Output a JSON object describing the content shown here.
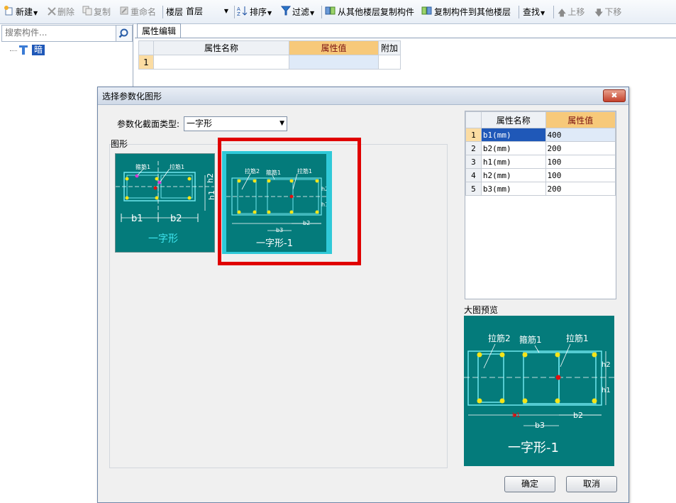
{
  "toolbar": {
    "new_label": "新建",
    "delete_label": "删除",
    "copy_label": "复制",
    "rename_label": "重命名",
    "floor_label": "楼层",
    "floor_value": "首层",
    "sort_label": "排序",
    "filter_label": "过滤",
    "copy_from_label": "从其他楼层复制构件",
    "copy_to_label": "复制构件到其他楼层",
    "find_label": "查找",
    "up_label": "上移",
    "down_label": "下移"
  },
  "left_panel": {
    "search_placeholder": "搜索构件...",
    "tree_item": "暗柱"
  },
  "property_panel": {
    "tab_label": "属性编辑",
    "headers": [
      "属性名称",
      "属性值",
      "附加"
    ],
    "row_number": "1"
  },
  "dialog": {
    "title": "选择参数化图形",
    "close_label": "✖",
    "section_type_label": "参数化截面类型:",
    "section_type_value": "一字形",
    "shapes_group_label": "图形",
    "shapes": [
      {
        "name": "一字形",
        "label_stirrup": "箍筋1",
        "label_tie": "拉筋1",
        "dims": [
          "b1",
          "b2",
          "h1",
          "h2"
        ]
      },
      {
        "name": "一字形-1",
        "label_tie2": "拉筋2",
        "label_stirrup": "箍筋1",
        "label_tie": "拉筋1",
        "dims": [
          "b3",
          "b2",
          "h2",
          "h1"
        ]
      }
    ],
    "params_headers": [
      "属性名称",
      "属性值"
    ],
    "params": [
      {
        "no": "1",
        "name": "b1(mm)",
        "value": "400"
      },
      {
        "no": "2",
        "name": "b2(mm)",
        "value": "200"
      },
      {
        "no": "3",
        "name": "h1(mm)",
        "value": "100"
      },
      {
        "no": "4",
        "name": "h2(mm)",
        "value": "100"
      },
      {
        "no": "5",
        "name": "b3(mm)",
        "value": "200"
      }
    ],
    "preview_label": "大图预览",
    "preview": {
      "name": "一字形-1",
      "label_tie2": "拉筋2",
      "label_stirrup": "箍筋1",
      "label_tie": "拉筋1",
      "dims": [
        "b3",
        "b2",
        "h2",
        "h1",
        "b1"
      ]
    },
    "ok_label": "确定",
    "cancel_label": "取消"
  },
  "colors": {
    "shape_bg": "#047b7b",
    "selected_bg": "#2fc9d8",
    "highlight_frame": "#e00000",
    "header_orange": "#f7c97a",
    "tree_selection": "#1f58b8"
  }
}
